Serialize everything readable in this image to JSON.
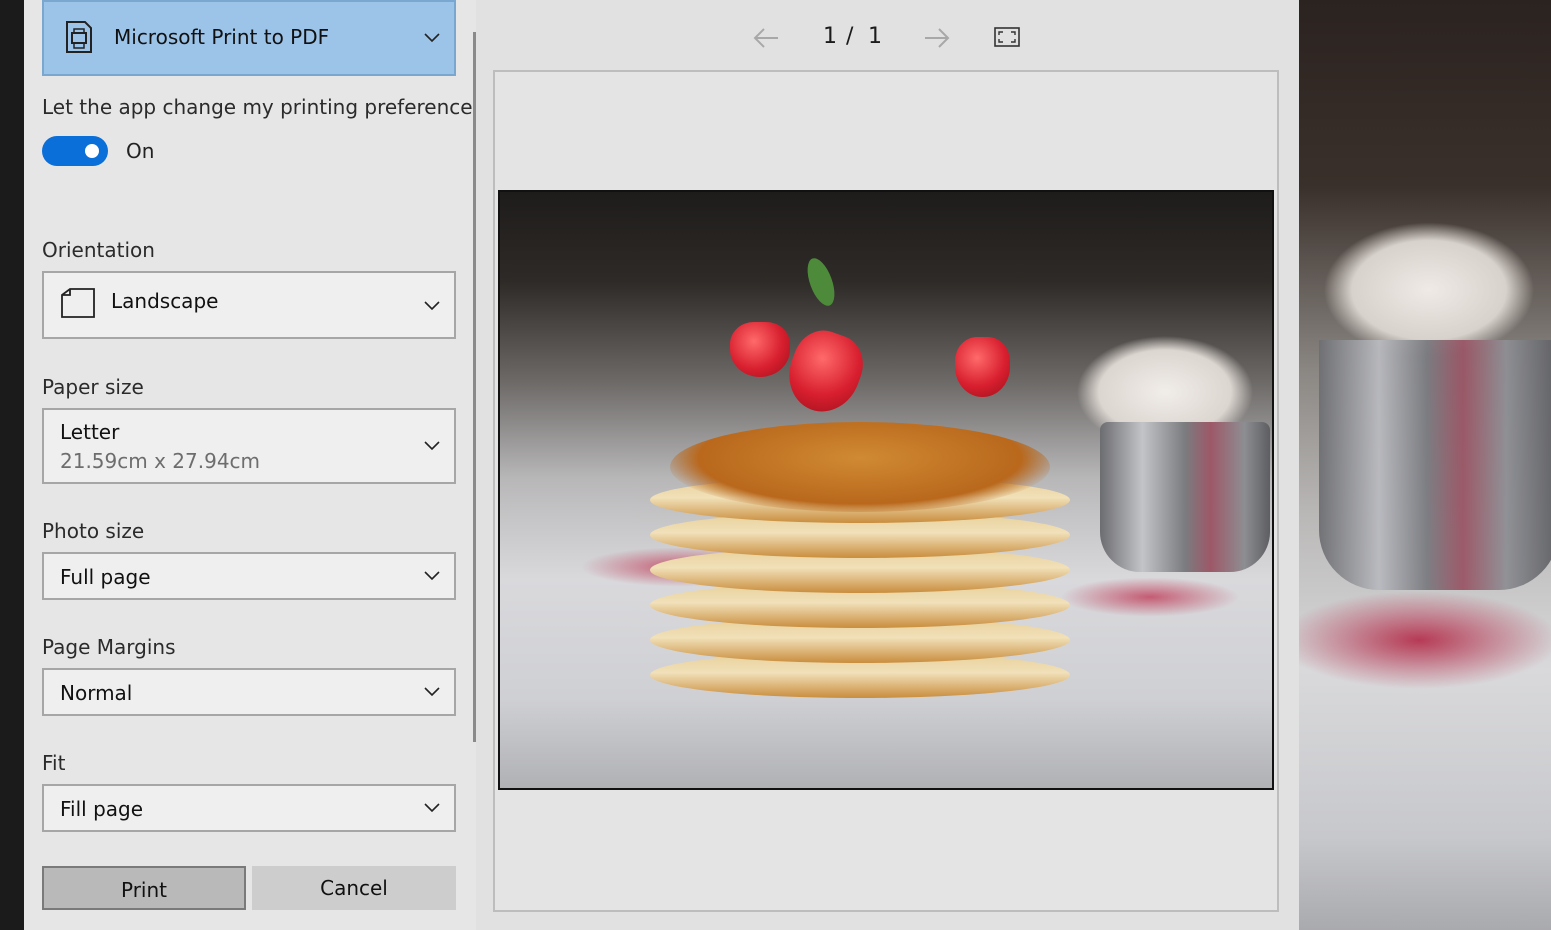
{
  "printer": {
    "name": "Microsoft Print to PDF"
  },
  "preferences": {
    "label": "Let the app change my printing preferences",
    "toggle_state": "On"
  },
  "orientation": {
    "label": "Orientation",
    "value": "Landscape"
  },
  "paper_size": {
    "label": "Paper size",
    "value": "Letter",
    "detail": "21.59cm x 27.94cm"
  },
  "photo_size": {
    "label": "Photo size",
    "value": "Full page"
  },
  "page_margins": {
    "label": "Page Margins",
    "value": "Normal"
  },
  "fit": {
    "label": "Fit",
    "value": "Fill page"
  },
  "buttons": {
    "print": "Print",
    "cancel": "Cancel"
  },
  "preview": {
    "current_page": "1",
    "separator": "/",
    "total_pages": "1"
  },
  "colors": {
    "accent": "#0a6fd8",
    "printer_bg": "#9cc4e8"
  }
}
